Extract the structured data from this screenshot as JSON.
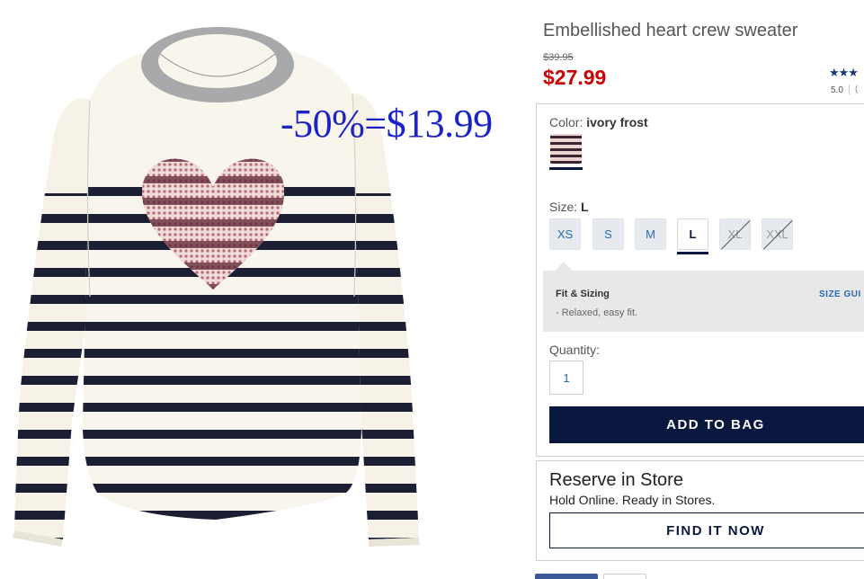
{
  "product": {
    "title": "Embellished heart crew sweater",
    "image_alt": "Embellished heart crew sweater in ivory frost with navy stripes",
    "promo_overlay": "-50%=$13.99"
  },
  "price": {
    "original": "$39.95",
    "sale": "$27.99"
  },
  "rating": {
    "stars": "★★★",
    "value": "5.0",
    "count_fragment": "("
  },
  "color": {
    "label": "Color:",
    "selected": "ivory frost"
  },
  "size": {
    "label": "Size:",
    "selected": "L",
    "options": [
      {
        "label": "XS",
        "available": true,
        "selected": false
      },
      {
        "label": "S",
        "available": true,
        "selected": false
      },
      {
        "label": "M",
        "available": true,
        "selected": false
      },
      {
        "label": "L",
        "available": true,
        "selected": true
      },
      {
        "label": "XL",
        "available": false,
        "selected": false
      },
      {
        "label": "XXL",
        "available": false,
        "selected": false
      }
    ]
  },
  "fit": {
    "title": "Fit & Sizing",
    "guide_link": "SIZE GUI",
    "detail": "-  Relaxed, easy fit."
  },
  "quantity": {
    "label": "Quantity:",
    "value": "1"
  },
  "actions": {
    "add_to_bag": "ADD TO BAG"
  },
  "reserve": {
    "title": "Reserve in Store",
    "subtitle": "Hold Online. Ready in Stores.",
    "button": "FIND IT NOW"
  },
  "colors": {
    "navy": "#0a1840",
    "sale_red": "#cc0000",
    "promo_blue": "#1b23c6",
    "link_blue": "#2a6bb0"
  }
}
